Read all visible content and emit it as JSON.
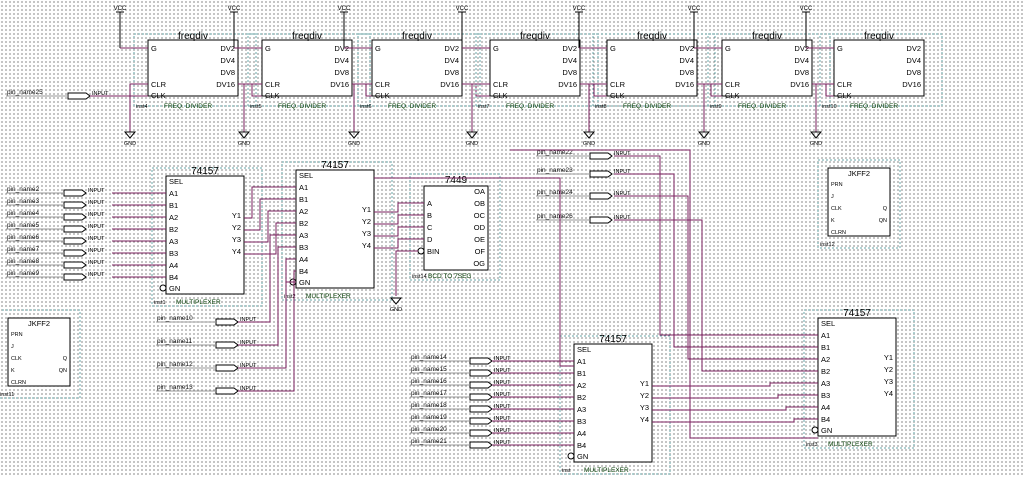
{
  "diagram": {
    "vcc_label": "VCC",
    "gnd_label": "GND",
    "input_label": "INPUT",
    "freqdivs": [
      {
        "title": "freqdiv",
        "inst": "inst4",
        "caption": "FREQ. DIVIDER"
      },
      {
        "title": "freqdiv",
        "inst": "inst5",
        "caption": "FREQ. DIVIDER"
      },
      {
        "title": "freqdiv",
        "inst": "inst6",
        "caption": "FREQ. DIVIDER"
      },
      {
        "title": "freqdiv",
        "inst": "inst7",
        "caption": "FREQ. DIVIDER"
      },
      {
        "title": "freqdiv",
        "inst": "inst8",
        "caption": "FREQ. DIVIDER"
      },
      {
        "title": "freqdiv",
        "inst": "inst9",
        "caption": "FREQ. DIVIDER"
      },
      {
        "title": "freqdiv",
        "inst": "inst10",
        "caption": "FREQ. DIVIDER"
      }
    ],
    "freqdiv_pins_left": [
      "G",
      "CLR",
      "CLK"
    ],
    "freqdiv_pins_right": [
      "DV2",
      "DV4",
      "DV8",
      "DV16"
    ],
    "clock_pin": "pin_name25",
    "mux_inputs": [
      "SEL",
      "A1",
      "B1",
      "A2",
      "B2",
      "A3",
      "B3",
      "A4",
      "B4",
      "GN"
    ],
    "mux_outputs": [
      "Y1",
      "Y2",
      "Y3",
      "Y4"
    ],
    "muxes": [
      {
        "title": "74157",
        "inst": "inst1",
        "caption": "MULTIPLEXER"
      },
      {
        "title": "74157",
        "inst": "inst2",
        "caption": "MULTIPLEXER"
      },
      {
        "title": "74157",
        "inst": "inst",
        "caption": "MULTIPLEXER"
      },
      {
        "title": "74157",
        "inst": "inst3",
        "caption": "MULTIPLEXER"
      }
    ],
    "bcd": {
      "title": "7449",
      "inst": "inst14",
      "caption": "BCD TO 7SEG",
      "inputs": [
        "A",
        "B",
        "C",
        "D",
        "BIN"
      ],
      "outputs": [
        "OA",
        "OB",
        "OC",
        "OD",
        "OE",
        "OF",
        "OG"
      ]
    },
    "jkff": [
      {
        "title": "JKFF2",
        "inst": "inst12"
      },
      {
        "title": "JKFF2",
        "inst": "inst11"
      }
    ],
    "jkff_pins": [
      "PRN",
      "J",
      "CLK",
      "K",
      "CLRN"
    ],
    "jkff_outputs": [
      "Q",
      "QN"
    ],
    "pins_mux1": [
      "pin_name2",
      "pin_name3",
      "pin_name4",
      "pin_name5",
      "pin_name6",
      "pin_name7",
      "pin_name8",
      "pin_name9"
    ],
    "pins_mid": [
      "pin_name10",
      "pin_name11",
      "pin_name12",
      "pin_name13"
    ],
    "pins_mux3": [
      "pin_name14",
      "pin_name15",
      "pin_name16",
      "pin_name17",
      "pin_name18",
      "pin_name19",
      "pin_name20",
      "pin_name21"
    ],
    "pins_right": [
      "pin_name22",
      "pin_name23",
      "pin_name24",
      "pin_name26"
    ]
  }
}
